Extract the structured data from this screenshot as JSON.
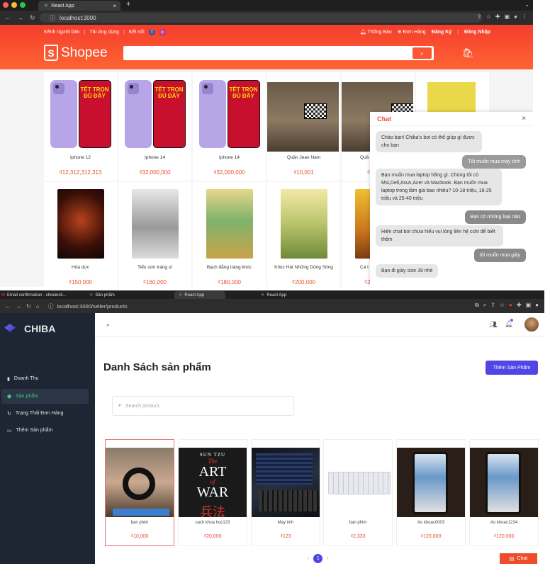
{
  "top_browser": {
    "tab_title": "React App",
    "url": "localhost:3000"
  },
  "shopee": {
    "top_left": [
      "Kênh người bán",
      "Tải ứng dụng",
      "Kết nối"
    ],
    "top_right": {
      "notifications": "Thông Báo",
      "orders": "Đơn Hàng",
      "register": "Đăng Ký",
      "login": "Đăng Nhập"
    },
    "logo_text": "Shopee",
    "poster_text": "TẾT TRỌN ĐỦ ĐẦY",
    "products": [
      {
        "name": "Iphone 12",
        "price": "₫12,312,312,313"
      },
      {
        "name": "Iphone 14",
        "price": "₫32,000,000"
      },
      {
        "name": "Iphone 14",
        "price": "₫32,000,000"
      },
      {
        "name": "Quần Jean Nam",
        "price": "₫10,001"
      },
      {
        "name": "Quầ",
        "price": "₫"
      },
      {
        "name": "",
        "price": ""
      },
      {
        "name": "Hỏa dực",
        "price": "₫150,000"
      },
      {
        "name": "Tiểu sơn tráng sĩ",
        "price": "₫160,000"
      },
      {
        "name": "Bạch đằng tráng khúc",
        "price": "₫180,000"
      },
      {
        "name": "Khúc Hát Những Dòng Sông",
        "price": "₫200,000"
      },
      {
        "name": "Cá t",
        "price": "₫2"
      }
    ],
    "book_covers": [
      "Hỏa dực",
      "Tiểu sơn tráng sĩ",
      "Bạch đằng tráng khúc",
      "Khúc hát những dòng sông"
    ],
    "chat": {
      "title": "Chat",
      "messages": [
        {
          "from": "bot",
          "text": "Chào bạn! Chiba's bot có thể giúp gì được cho bạn"
        },
        {
          "from": "user",
          "text": "Tôi muốn mua máy tính"
        },
        {
          "from": "bot",
          "text": "Bạn muốn mua laptop hãng gì. Chúng tôi có Msi,Dell,Asus,Acer và Macbook. Bạn muốn mua laptop trong tầm giá bao nhiêu? 10-18 triệu, 18-25 triệu và 25-40 triệu"
        },
        {
          "from": "user",
          "text": "Bạn có những loại nào"
        },
        {
          "from": "bot",
          "text": "Hiện chat bot chưa hiểu vui lòng liên hệ csht để biết thêm"
        },
        {
          "from": "user",
          "text": "tôi muốn mua giày"
        },
        {
          "from": "bot",
          "text": "Bạn đi giày size 39 nhé"
        }
      ]
    }
  },
  "bottom_browser": {
    "tabs": [
      "Email confirmation - shoeinsti...",
      "Sản phẩm",
      "React App",
      "React App"
    ],
    "url": "localhost:3000/seller/products"
  },
  "seller": {
    "brand": "CHIBA",
    "menu": [
      {
        "label": "Doanh Thu",
        "icon": "chart-icon",
        "active": false
      },
      {
        "label": "Sản phẩm",
        "icon": "bag-icon",
        "active": true
      },
      {
        "label": "Trạng Thái Đơn Hàng",
        "icon": "refresh-icon",
        "active": false
      },
      {
        "label": "Thêm Sản phẩm",
        "icon": "card-icon",
        "active": false
      }
    ],
    "page_title": "Danh Sách sản phẩm",
    "add_button": "Thêm Sản Phẩm",
    "search_placeholder": "Search product",
    "products": [
      {
        "name": "ban phim",
        "price": "₫10,000"
      },
      {
        "name": "sach khoa hoc123",
        "price": "₫20,000"
      },
      {
        "name": "May tinh",
        "price": "₫123"
      },
      {
        "name": "ban phim",
        "price": "₫2,333"
      },
      {
        "name": "Ao khoac0003",
        "price": "₫120,000"
      },
      {
        "name": "Ao khoac1234",
        "price": "₫120,000"
      }
    ],
    "book_cover": {
      "author": "SUN TZU",
      "line1": "The",
      "line2": "ART",
      "line3": "of",
      "line4": "WAR",
      "kanji": "兵法"
    },
    "pagination": {
      "current": "1",
      "prev": "‹",
      "next": "›"
    },
    "chat_button": "Chat"
  }
}
